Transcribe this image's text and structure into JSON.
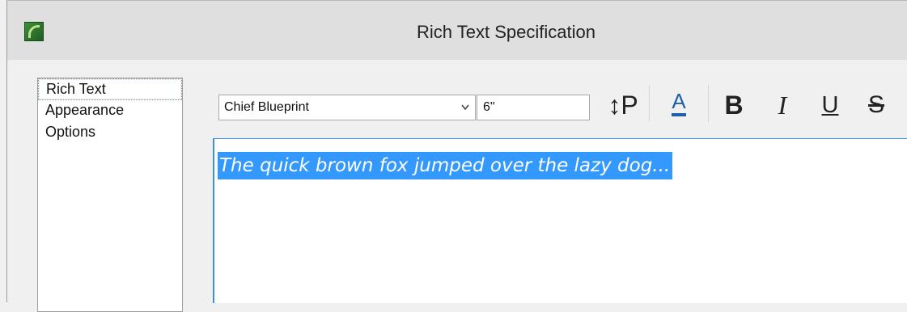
{
  "window": {
    "title": "Rich Text Specification"
  },
  "sidebar": {
    "items": [
      {
        "label": "Rich Text",
        "selected": true
      },
      {
        "label": "Appearance",
        "selected": false
      },
      {
        "label": "Options",
        "selected": false
      }
    ]
  },
  "toolbar": {
    "font": {
      "value": "Chief Blueprint"
    },
    "size": {
      "value": "6\""
    },
    "line_spacing_glyph": "↕P",
    "font_color_glyph": "A",
    "bold_glyph": "B",
    "italic_glyph": "I",
    "underline_glyph": "U",
    "strikethrough_glyph": "S",
    "font_color_accent": "#1f5fa8"
  },
  "editor": {
    "text": "The quick brown fox jumped over the lazy dog...",
    "selection_color": "#3399ff"
  }
}
